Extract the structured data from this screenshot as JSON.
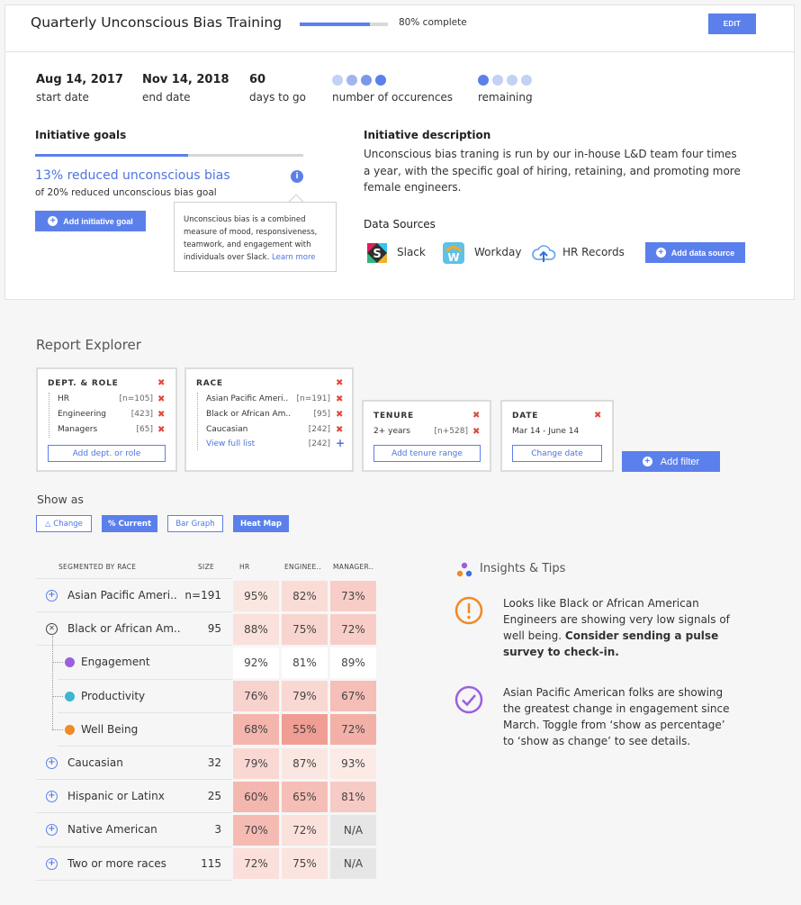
{
  "header": {
    "title": "Quarterly Unconscious Bias Training",
    "progress_fraction": 0.8,
    "progress_text": "80% complete",
    "edit_label": "EDIT"
  },
  "stats": [
    {
      "value": "Aug 14, 2017",
      "label": "start date"
    },
    {
      "value": "Nov 14, 2018",
      "label": "end date"
    },
    {
      "value": "60",
      "label": "days to go"
    }
  ],
  "occurrences": {
    "label": "number of occurences",
    "total": 4,
    "completed": 4
  },
  "remaining": {
    "label": "remaining",
    "total": 4,
    "filled": 1
  },
  "goals": {
    "title": "Initiative goals",
    "progress_fraction": 0.57,
    "value": "13% reduced unconscious bias",
    "sub": "of 20% reduced unconscious bias goal",
    "add_label": "Add initiative goal",
    "tooltip_text": "Unconscious bias is a combined measure of mood, responsiveness, teamwork, and engagement with individuals over Slack.",
    "tooltip_link": "Learn more"
  },
  "description": {
    "title": "Initiative description",
    "text": "Unconscious bias traning is run by our in-house L&D team four times a year, with the specific goal of hiring, retaining, and promoting more female engineers."
  },
  "data_sources": {
    "title": "Data Sources",
    "items": [
      {
        "name": "Slack",
        "icon": "slack-icon"
      },
      {
        "name": "Workday",
        "icon": "workday-icon"
      },
      {
        "name": "HR Records",
        "icon": "cloud-upload-icon"
      }
    ],
    "add_label": "Add data source"
  },
  "report": {
    "title": "Report Explorer",
    "filters": {
      "dept": {
        "title": "DEPT. & ROLE",
        "rows": [
          {
            "label": "HR",
            "count": "[n=105]"
          },
          {
            "label": "Engineering",
            "count": "[423]"
          },
          {
            "label": "Managers",
            "count": "[65]"
          }
        ],
        "button": "Add dept. or role"
      },
      "race": {
        "title": "RACE",
        "rows": [
          {
            "label": "Asian Pacific Ameri..",
            "count": "[n=191]"
          },
          {
            "label": "Black or African Am..",
            "count": "[95]"
          },
          {
            "label": "Caucasian",
            "count": "[242]"
          }
        ],
        "link": "View full list",
        "link_count": "[242]"
      },
      "tenure": {
        "title": "TENURE",
        "rows": [
          {
            "label": "2+ years",
            "count": "[n+528]"
          }
        ],
        "button": "Add tenure range"
      },
      "date": {
        "title": "DATE",
        "rows": [
          {
            "label": "Mar 14 - June 14"
          }
        ],
        "button": "Change date"
      }
    },
    "add_filter": "Add filter",
    "show_as": {
      "label": "Show as",
      "options": [
        {
          "label": "Change",
          "icon": "triangle-icon",
          "active": false
        },
        {
          "label": "% Current",
          "active": true
        },
        {
          "label": "Bar Graph",
          "active": false
        },
        {
          "label": "Heat Map",
          "active": true
        }
      ]
    }
  },
  "table": {
    "headers": {
      "segment": "SEGMENTED BY RACE",
      "size": "SIZE",
      "hr": "HR",
      "eng": "ENGINEE..",
      "mgr": "MANAGER.."
    },
    "rows": [
      {
        "label": "Asian Pacific Ameri..",
        "size": "n=191",
        "state": "expand",
        "cells": [
          "95%",
          "82%",
          "73%"
        ],
        "heat": [
          0.05,
          0.15,
          0.28
        ]
      },
      {
        "label": "Black or African Am..",
        "size": "95",
        "state": "collapse",
        "cells": [
          "88%",
          "75%",
          "72%"
        ],
        "heat": [
          0.1,
          0.22,
          0.28
        ]
      },
      {
        "label": "Engagement",
        "size": "",
        "state": "sub",
        "dot": "#9b5fe0",
        "cells": [
          "92%",
          "81%",
          "89%"
        ],
        "heat": [
          0.0,
          0.0,
          0.0
        ]
      },
      {
        "label": "Productivity",
        "size": "",
        "state": "sub",
        "dot": "#3bb6d3",
        "cells": [
          "76%",
          "79%",
          "67%"
        ],
        "heat": [
          0.24,
          0.18,
          0.42
        ]
      },
      {
        "label": "Well Being",
        "size": "",
        "state": "sub",
        "dot": "#f08a24",
        "cells": [
          "68%",
          "55%",
          "72%"
        ],
        "heat": [
          0.5,
          0.72,
          0.55
        ]
      },
      {
        "label": "Caucasian",
        "size": "32",
        "state": "expand",
        "cells": [
          "79%",
          "87%",
          "93%"
        ],
        "heat": [
          0.18,
          0.05,
          0.02
        ]
      },
      {
        "label": "Hispanic or Latinx",
        "size": "25",
        "state": "expand",
        "cells": [
          "60%",
          "65%",
          "81%"
        ],
        "heat": [
          0.48,
          0.42,
          0.3
        ]
      },
      {
        "label": "Native American",
        "size": "3",
        "state": "expand",
        "cells": [
          "70%",
          "72%",
          "N/A"
        ],
        "heat": [
          0.45,
          0.1,
          -1
        ]
      },
      {
        "label": "Two or more races",
        "size": "115",
        "state": "expand",
        "cells": [
          "72%",
          "75%",
          "N/A"
        ],
        "heat": [
          0.12,
          0.08,
          -1
        ]
      }
    ]
  },
  "insights": {
    "title": "Insights & Tips",
    "items": [
      {
        "icon": "warning-icon",
        "color": "#f08a24",
        "text": "Looks like Black or African American Engineers are showing very low signals of well being.",
        "bold": "Consider sending a pulse survey to check-in."
      },
      {
        "icon": "check-circle-icon",
        "color": "#9b5fe0",
        "text": "Asian Pacific American folks are showing the greatest change in engagement since March. Toggle from ‘show as percentage’ to ‘show as change’ to see details.",
        "bold": ""
      }
    ]
  },
  "colors": {
    "accent": "#5b80ec",
    "danger": "#e0493a"
  }
}
